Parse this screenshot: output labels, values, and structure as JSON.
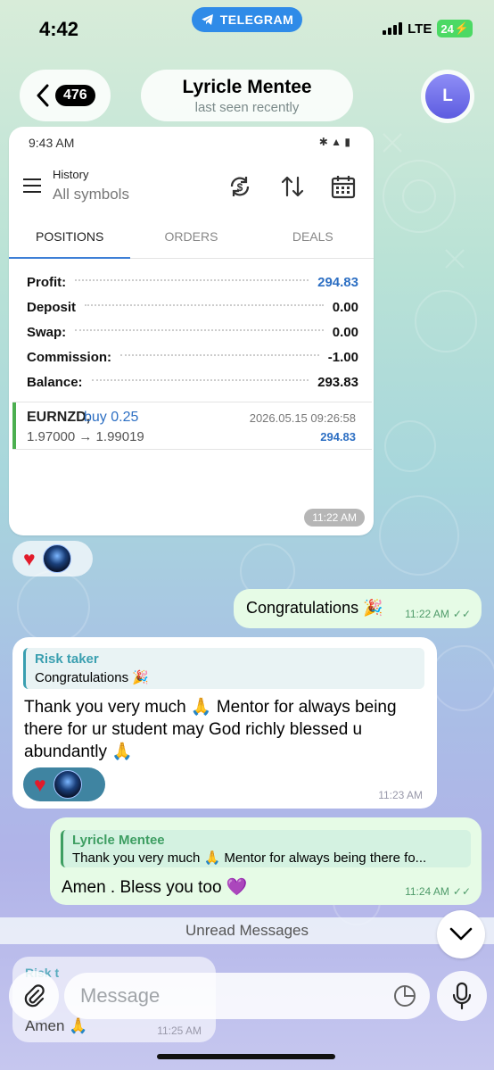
{
  "status_bar": {
    "time": "4:42",
    "app_pill": "TELEGRAM",
    "network": "LTE",
    "battery": "24"
  },
  "header": {
    "back_count": "476",
    "name": "Lyricle Mentee",
    "subtitle": "last seen recently",
    "avatar_initial": "L"
  },
  "screenshot": {
    "status_time": "9:43 AM",
    "title": "History",
    "subtitle": "All symbols",
    "tabs": [
      "POSITIONS",
      "ORDERS",
      "DEALS"
    ],
    "rows": [
      {
        "label": "Profit:",
        "value": "294.83"
      },
      {
        "label": "Deposit",
        "value": "0.00"
      },
      {
        "label": "Swap:",
        "value": "0.00"
      },
      {
        "label": "Commission:",
        "value": "-1.00"
      },
      {
        "label": "Balance:",
        "value": "293.83"
      }
    ],
    "deal": {
      "symbol": "EURNZD,",
      "side": "buy 0.25",
      "prices": "1.97000 → 1.99019",
      "datetime": "2026.05.15 09:26:58",
      "profit": "294.83"
    },
    "time": "11:22 AM"
  },
  "messages": {
    "congrats": {
      "text": "Congratulations 🎉",
      "time": "11:22 AM"
    },
    "thanks": {
      "reply_name": "Risk taker",
      "reply_text": "Congratulations 🎉",
      "body": "Thank you very much 🙏 Mentor for always being there for ur student may God richly blessed u abundantly 🙏",
      "time": "11:23 AM"
    },
    "amen": {
      "reply_name": "Lyricle Mentee",
      "reply_text": "Thank you very much 🙏 Mentor for always being there fo...",
      "text": "Amen . Bless you too 💜",
      "time": "11:24 AM"
    },
    "last": {
      "reply_name": "Risk t",
      "text": "Amen 🙏",
      "time": "11:25 AM"
    }
  },
  "unread_label": "Unread Messages",
  "composer": {
    "placeholder": "Message"
  },
  "colors": {
    "accent": "#2f8be8",
    "outgoing_bubble": "#e6fbe6",
    "profit_blue": "#2d6fc3",
    "deal_bar": "#4caf50"
  }
}
